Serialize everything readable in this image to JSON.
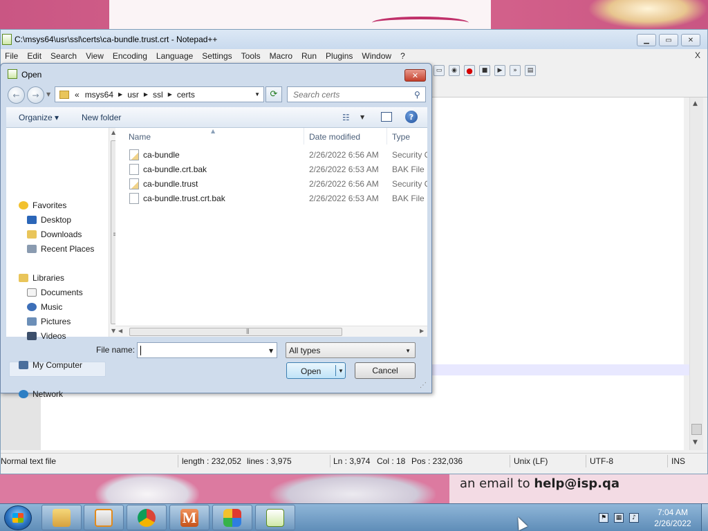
{
  "desktop": {
    "email_text_prefix": "an email to ",
    "email_address": "help@isp.qa"
  },
  "npp": {
    "title": "C:\\msys64\\usr\\ssl\\certs\\ca-bundle.trust.crt - Notepad++",
    "menu": [
      "File",
      "Edit",
      "Search",
      "View",
      "Encoding",
      "Language",
      "Settings",
      "Tools",
      "Macro",
      "Run",
      "Plugins",
      "Window",
      "?"
    ],
    "menu_close": "X",
    "status": {
      "file_type": "Normal text file",
      "length": "length : 232,052",
      "lines": "lines : 3,975",
      "ln": "Ln : 3,974",
      "col": "Col : 18",
      "pos": "Pos : 232,036",
      "eol": "Unix (LF)",
      "encoding": "UTF-8",
      "mode": "INS"
    }
  },
  "dialog": {
    "title": "Open",
    "address": {
      "overflow": "«",
      "segments": [
        "msys64",
        "usr",
        "ssl",
        "certs"
      ]
    },
    "search_placeholder": "Search certs",
    "organize_label": "Organize",
    "new_folder_label": "New folder",
    "nav": {
      "favorites": "Favorites",
      "desktop": "Desktop",
      "downloads": "Downloads",
      "recent": "Recent Places",
      "libraries": "Libraries",
      "documents": "Documents",
      "music": "Music",
      "pictures": "Pictures",
      "videos": "Videos",
      "my_computer": "My Computer",
      "network": "Network"
    },
    "columns": {
      "name": "Name",
      "date": "Date modified",
      "type": "Type"
    },
    "files": [
      {
        "name": "ca-bundle",
        "date": "2/26/2022 6:56 AM",
        "type": "Security C",
        "icon": "certificate-icon"
      },
      {
        "name": "ca-bundle.crt.bak",
        "date": "2/26/2022 6:53 AM",
        "type": "BAK File",
        "icon": "file-icon"
      },
      {
        "name": "ca-bundle.trust",
        "date": "2/26/2022 6:56 AM",
        "type": "Security C",
        "icon": "certificate-icon"
      },
      {
        "name": "ca-bundle.trust.crt.bak",
        "date": "2/26/2022 6:53 AM",
        "type": "BAK File",
        "icon": "file-icon"
      }
    ],
    "file_name_label": "File name:",
    "file_name_value": "",
    "filter_value": "All types",
    "open_label": "Open",
    "cancel_label": "Cancel"
  },
  "taskbar": {
    "apps": [
      "windows-explorer",
      "media-player",
      "chrome",
      "m-app",
      "game",
      "notepad-plus-plus"
    ],
    "time": "7:04 AM",
    "date": "2/26/2022"
  }
}
